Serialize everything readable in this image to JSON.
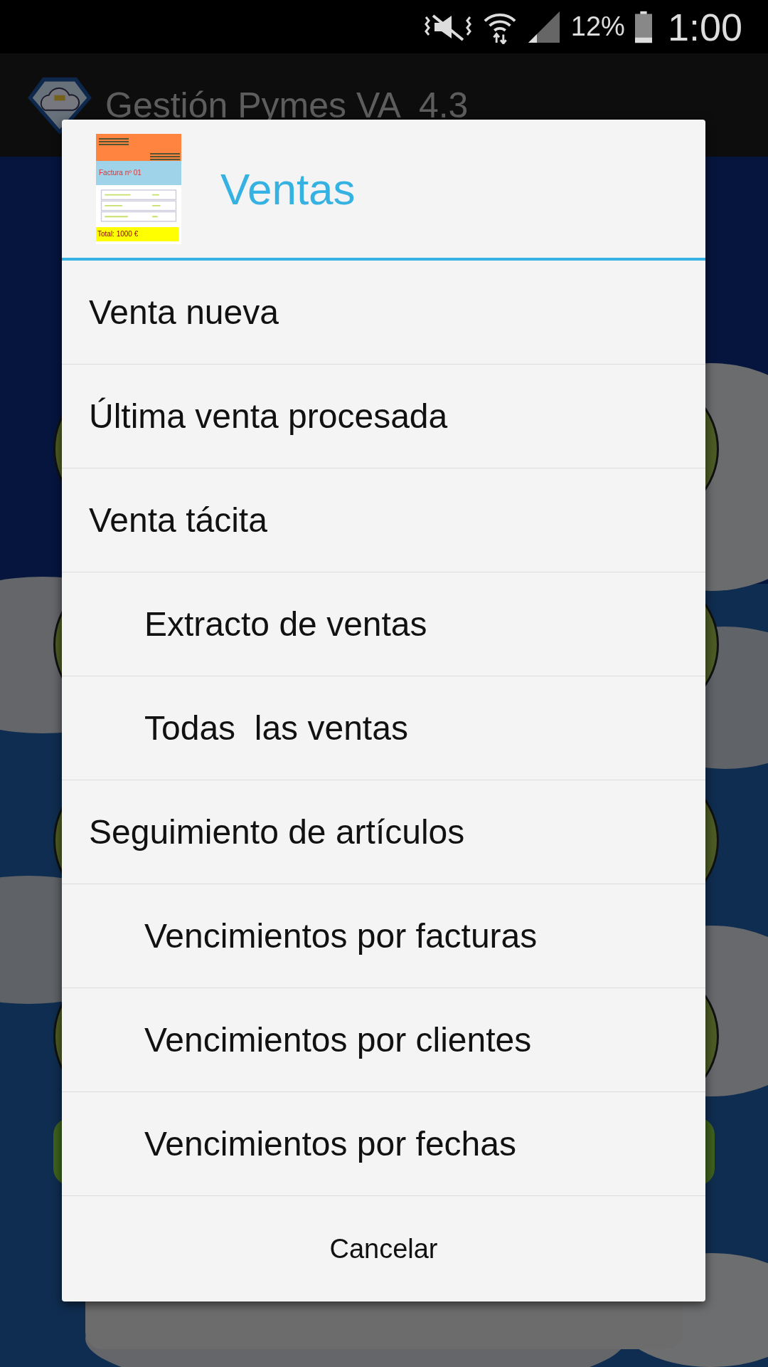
{
  "status_bar": {
    "battery": "12%",
    "time": "1:00"
  },
  "app_bar": {
    "title": "Gestión Pymes VA  4.3"
  },
  "dialog": {
    "title": "Ventas",
    "icon_texts": {
      "heading": "Factura nº 01",
      "total": "Total: 1000 €"
    },
    "items": [
      {
        "label": "Venta nueva"
      },
      {
        "label": "Última venta procesada"
      },
      {
        "label": "Venta tácita",
        "children": [
          {
            "label": "Extracto de ventas"
          },
          {
            "label": "Todas  las ventas"
          }
        ]
      },
      {
        "label": "Seguimiento de artículos",
        "children": [
          {
            "label": "Vencimientos por facturas"
          },
          {
            "label": "Vencimientos por clientes"
          },
          {
            "label": "Vencimientos por fechas"
          }
        ]
      }
    ],
    "cancel": "Cancelar"
  }
}
